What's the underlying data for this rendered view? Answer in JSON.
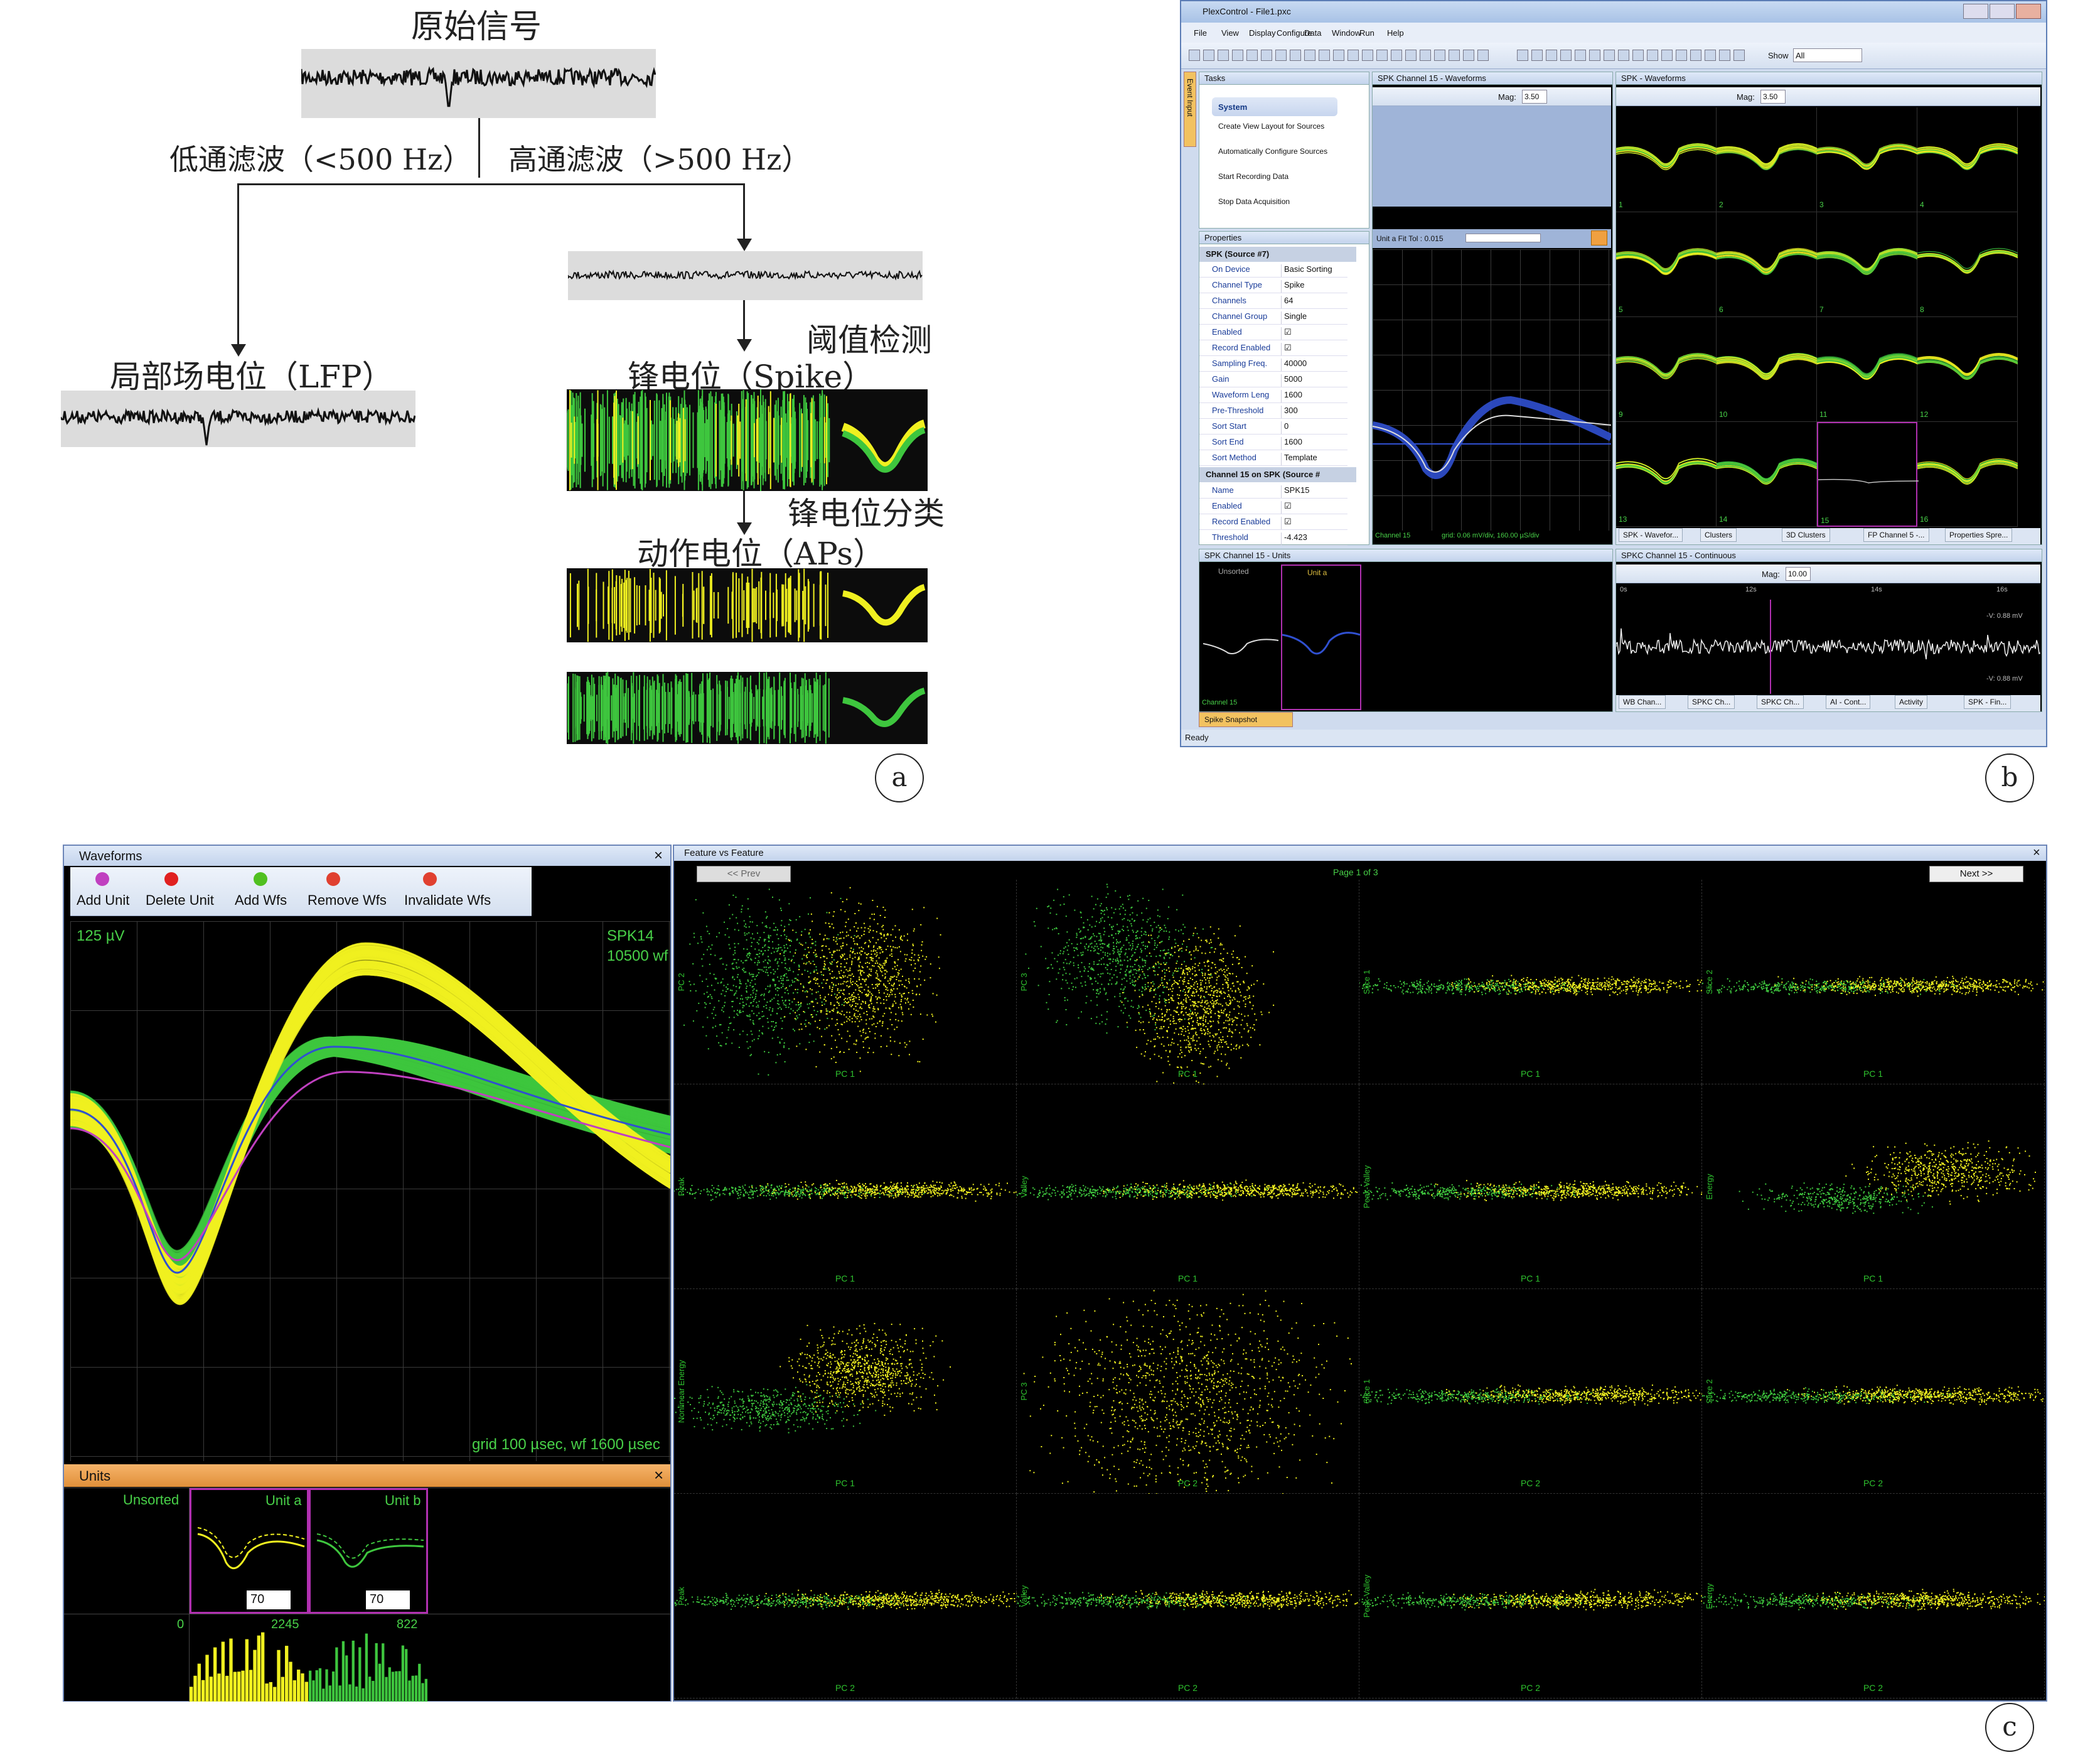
{
  "panel_a": {
    "raw_title": "原始信号",
    "lowpass": "低通滤波（<500 Hz）",
    "highpass": "高通滤波（>500 Hz）",
    "lfp": "局部场电位（LFP）",
    "threshold": "阈值检测",
    "spike": "锋电位（Spike）",
    "sorting": "锋电位分类",
    "aps": "动作电位（APs）",
    "label": "a"
  },
  "panel_b": {
    "title": "PlexControl - File1.pxc",
    "menu": [
      "File",
      "View",
      "Display",
      "Configure",
      "Data",
      "Window",
      "Run",
      "Help"
    ],
    "show_label": "Show",
    "show_value": "All",
    "tasks_title": "Tasks",
    "event_input_tab": "Event Input",
    "system_label": "System",
    "tasks": [
      "Create View Layout for Sources",
      "Automatically Configure Sources",
      "Start Recording Data",
      "Stop Data Acquisition"
    ],
    "properties_title": "Properties",
    "source_header": "SPK (Source #7)",
    "props": [
      {
        "k": "On Device",
        "v": "Basic Sorting"
      },
      {
        "k": "Channel Type",
        "v": "Spike"
      },
      {
        "k": "Channels",
        "v": "64"
      },
      {
        "k": "Channel Group",
        "v": "Single"
      },
      {
        "k": "Enabled",
        "v": "☑"
      },
      {
        "k": "Record Enabled",
        "v": "☑"
      },
      {
        "k": "Sampling Freq.",
        "v": "40000"
      },
      {
        "k": "Gain",
        "v": "5000"
      },
      {
        "k": "Waveform Leng",
        "v": "1600"
      },
      {
        "k": "Pre-Threshold",
        "v": "300"
      },
      {
        "k": "Sort Start",
        "v": "0"
      },
      {
        "k": "Sort End",
        "v": "1600"
      },
      {
        "k": "Sort Method",
        "v": "Template"
      }
    ],
    "channel_header": "Channel 15 on SPK (Source #",
    "props2": [
      {
        "k": "Name",
        "v": "SPK15"
      },
      {
        "k": "Enabled",
        "v": "☑"
      },
      {
        "k": "Record Enabled",
        "v": "☑"
      },
      {
        "k": "Threshold",
        "v": "-4.423"
      }
    ],
    "ch15_title": "SPK Channel 15 - Waveforms",
    "mag_label": "Mag:",
    "mag_value": "3.50",
    "fit_tol": "Unit a Fit Tol : 0.015",
    "ch15_footer_left": "Channel 15",
    "ch15_footer_grid": "grid: 0.06 mV/div, 160.00 µS/div",
    "spk_title": "SPK - Waveforms",
    "cells": [
      "1",
      "2",
      "3",
      "4",
      "5",
      "6",
      "7",
      "8",
      "9",
      "10",
      "11",
      "12",
      "13",
      "14",
      "15",
      "16"
    ],
    "bottom_tabs": [
      "SPK - Wavefor...",
      "Clusters",
      "3D Clusters",
      "FP Channel 5 -...",
      "Properties Spre..."
    ],
    "units_title": "SPK Channel 15 - Units",
    "unsorted": "Unsorted",
    "unit_a": "Unit a",
    "units_footer": "Channel 15",
    "snapshot": "Spike Snapshot",
    "cont_title": "SPKC Channel 15 - Continuous",
    "cont_mag": "10.00",
    "time_ticks": [
      "0s",
      "12s",
      "14s",
      "16s"
    ],
    "volt_top": "-V: 0.88 mV",
    "volt_bot": "-V: 0.88 mV",
    "bottom_tabs2": [
      "WB Chan...",
      "SPKC Ch...",
      "SPKC Ch...",
      "AI - Cont...",
      "Activity",
      "SPK - Fin..."
    ],
    "status": "Ready",
    "label": "b"
  },
  "panel_c": {
    "waveforms_title": "Waveforms",
    "toolbar": [
      "Add Unit",
      "Delete Unit",
      "Add Wfs",
      "Remove Wfs",
      "Invalidate Wfs"
    ],
    "scale": "125 µV",
    "channel": "SPK14",
    "count": "10500 wf",
    "grid_label": "grid 100 µsec, wf 1600 µsec",
    "units_title": "Units",
    "unit_names": [
      "Unsorted",
      "Unit a",
      "Unit b"
    ],
    "unit_spin": [
      "70",
      "70"
    ],
    "hist_labels": [
      "0",
      "2245",
      "822"
    ],
    "fvf_title": "Feature vs Feature",
    "prev": "<< Prev",
    "next": "Next >>",
    "page": "Page 1 of 3",
    "cells": [
      {
        "x": "PC 1",
        "y": "PC 2"
      },
      {
        "x": "PC 1",
        "y": "PC 3"
      },
      {
        "x": "PC 1",
        "y": "Slice 1"
      },
      {
        "x": "PC 1",
        "y": "Slice 2"
      },
      {
        "x": "PC 1",
        "y": "Peak"
      },
      {
        "x": "PC 1",
        "y": "Valley"
      },
      {
        "x": "PC 1",
        "y": "Peak-Valley"
      },
      {
        "x": "PC 1",
        "y": "Energy"
      },
      {
        "x": "PC 1",
        "y": "Nonlinear Energy"
      },
      {
        "x": "PC 2",
        "y": "PC 3"
      },
      {
        "x": "PC 2",
        "y": "Slice 1"
      },
      {
        "x": "PC 2",
        "y": "Slice 2"
      },
      {
        "x": "PC 2",
        "y": "Peak"
      },
      {
        "x": "PC 2",
        "y": "Valley"
      },
      {
        "x": "PC 2",
        "y": "Peak-Valley"
      },
      {
        "x": "PC 2",
        "y": "Energy"
      }
    ],
    "label": "c"
  },
  "colors": {
    "green": "#3ec63e",
    "yellow": "#f0f020",
    "blue": "#3050d0",
    "magenta": "#c040c0",
    "dark": "#0c0c0c"
  }
}
